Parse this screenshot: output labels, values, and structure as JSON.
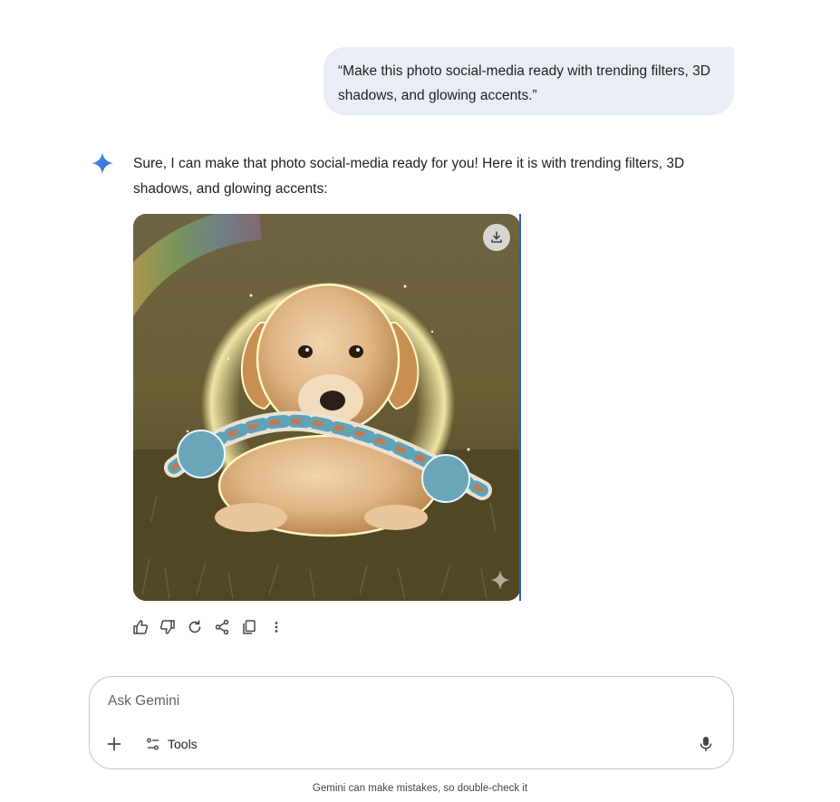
{
  "conversation": {
    "user_message": "“Make this photo social-media ready with trending filters, 3D shadows, and glowing accents.”",
    "assistant_reply": "Sure, I can make that photo social-media ready for you! Here it is with trending filters, 3D shadows, and glowing accents:",
    "assistant_icon": "gemini-spark-icon",
    "generated_image": {
      "subject": "golden retriever puppy chewing a rope toy on grass",
      "download_icon": "download-icon",
      "watermark_icon": "spark-watermark-icon"
    },
    "response_actions": [
      {
        "name": "thumbs-up-icon"
      },
      {
        "name": "thumbs-down-icon"
      },
      {
        "name": "regenerate-icon"
      },
      {
        "name": "share-icon"
      },
      {
        "name": "copy-icon"
      },
      {
        "name": "more-vert-icon"
      }
    ]
  },
  "composer": {
    "placeholder": "Ask Gemini",
    "tools_label": "Tools",
    "plus_icon": "plus-icon",
    "tools_icon": "tools-icon",
    "mic_icon": "mic-icon"
  },
  "footer": {
    "disclaimer": "Gemini can make mistakes, so double-check it"
  },
  "colors": {
    "accent": "#4285f4",
    "bubble": "#e9eef6",
    "border": "#c4c7c5"
  }
}
